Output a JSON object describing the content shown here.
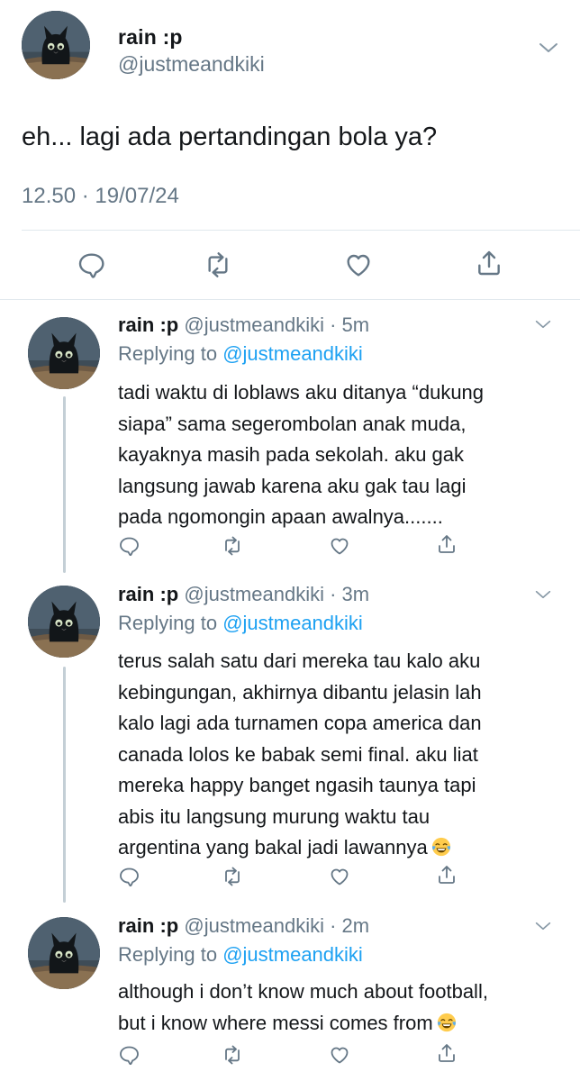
{
  "main_tweet": {
    "name": "rain :p",
    "handle": "@justmeandkiki",
    "text": "eh... lagi ada pertandingan bola ya?",
    "timestamp": "12.50 · 19/07/24",
    "actions": [
      "reply-icon",
      "retweet-icon",
      "like-icon",
      "share-icon"
    ]
  },
  "replies": [
    {
      "name": "rain :p",
      "handle_time": "@justmeandkiki · 5m",
      "replying_prefix": "Replying to ",
      "replying_to": "@justmeandkiki",
      "lines": [
        "tadi waktu di loblaws aku ditanya “dukung",
        "siapa” sama segerombolan anak muda,",
        "kayaknya masih pada sekolah. aku gak",
        "langsung jawab karena aku gak tau lagi",
        "pada ngomongin apaan awalnya......."
      ]
    },
    {
      "name": "rain :p",
      "handle_time": "@justmeandkiki · 3m",
      "replying_prefix": "Replying to ",
      "replying_to": "@justmeandkiki",
      "lines": [
        "terus salah satu dari mereka tau kalo aku",
        "kebingungan, akhirnya dibantu jelasin lah",
        "kalo lagi ada turnamen copa america dan",
        "canada lolos ke babak semi final. aku liat",
        "mereka happy banget ngasih taunya tapi",
        "abis itu langsung murung waktu tau",
        "argentina yang bakal jadi lawannya"
      ],
      "emoji": "face-with-tears-of-joy"
    },
    {
      "name": "rain :p",
      "handle_time": "@justmeandkiki · 2m",
      "replying_prefix": "Replying to ",
      "replying_to": "@justmeandkiki",
      "lines": [
        "although i don’t know much about football,",
        "but i know where messi comes from"
      ],
      "emoji": "face-with-tears-of-joy"
    }
  ],
  "colors": {
    "text": "#14171a",
    "secondary": "#657786",
    "link": "#1da1f2",
    "divider": "#e1e8ed",
    "thread_line": "#c4cfd6"
  }
}
